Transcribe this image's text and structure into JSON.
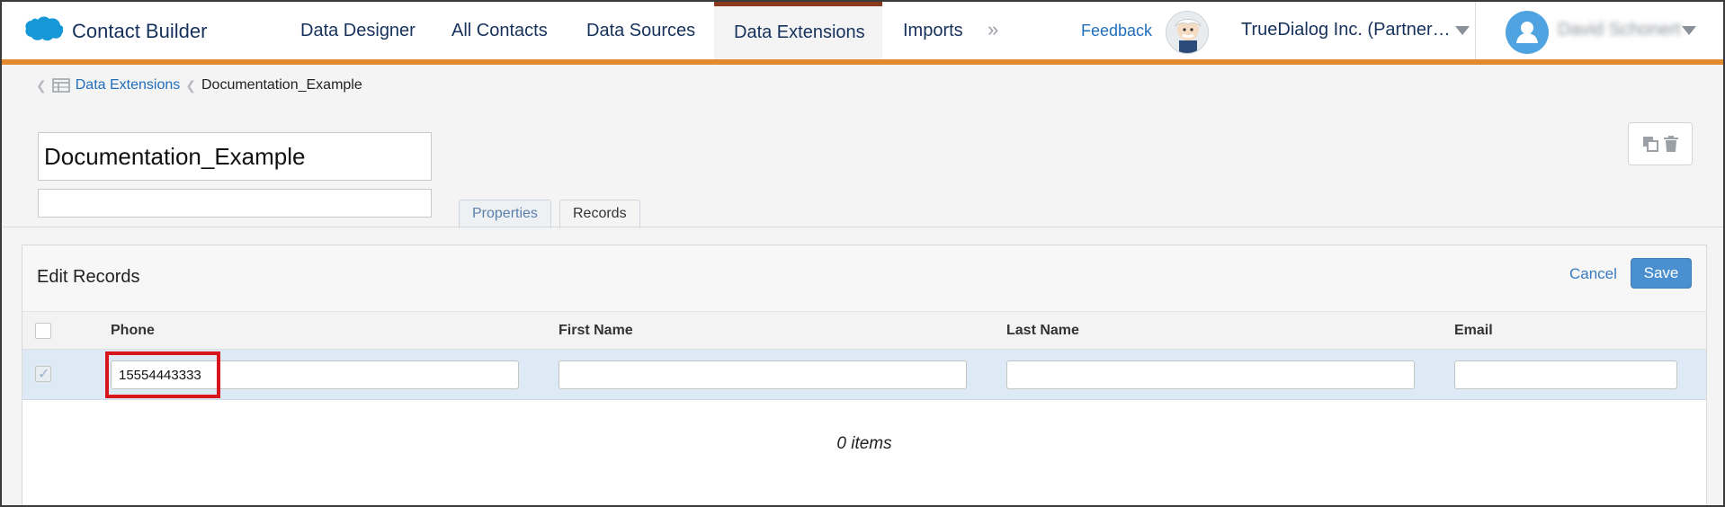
{
  "app": {
    "title": "Contact Builder"
  },
  "nav": {
    "tabs": [
      {
        "label": "Data Designer"
      },
      {
        "label": "All Contacts"
      },
      {
        "label": "Data Sources"
      },
      {
        "label": "Data Extensions",
        "active": true
      },
      {
        "label": "Imports"
      }
    ],
    "more_glyph": "»",
    "feedback": "Feedback",
    "org": "TrueDialog Inc. (Partner…",
    "user": "David Schonert"
  },
  "breadcrumb": {
    "parent": "Data Extensions",
    "current": "Documentation_Example"
  },
  "extension": {
    "name": "Documentation_Example",
    "description": ""
  },
  "subtabs": [
    {
      "label": "Properties"
    },
    {
      "label": "Records",
      "active": true
    }
  ],
  "panel": {
    "title": "Edit Records",
    "cancel": "Cancel",
    "save": "Save"
  },
  "table": {
    "columns": [
      "Phone",
      "First Name",
      "Last Name",
      "Email"
    ],
    "row": {
      "phone": "15554443333",
      "first_name": "",
      "last_name": "",
      "email": ""
    },
    "footer": "0 items"
  },
  "colors": {
    "accent_orange": "#e28b2e",
    "active_tab_top": "#8b3a1e",
    "link_blue": "#1f6dbb",
    "save_blue": "#4a8fd0",
    "row_highlight": "#dde9f5",
    "annotation_red": "#d9141b"
  },
  "icons": [
    "salesforce-cloud-icon",
    "einstein-icon",
    "user-avatar-icon",
    "chevron-down-icon",
    "table-icon",
    "copy-icon",
    "trash-icon",
    "checkbox-icon"
  ]
}
